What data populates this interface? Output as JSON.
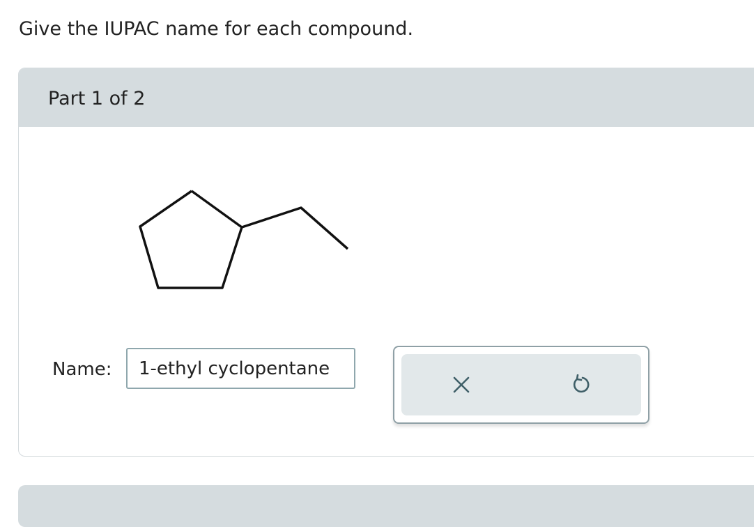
{
  "question": {
    "prompt": "Give the IUPAC name for each compound."
  },
  "part": {
    "title": "Part 1 of 2"
  },
  "molecule": {
    "structure": "ethylcyclopentane skeletal formula"
  },
  "answer": {
    "label": "Name:",
    "value": "1-ethyl cyclopentane"
  },
  "actions": {
    "clear_icon": "close-icon",
    "undo_icon": "undo-icon"
  },
  "colors": {
    "header_bg": "#d5dcdf",
    "panel_bg": "#e2e8ea",
    "icon_color": "#3f5f68"
  }
}
